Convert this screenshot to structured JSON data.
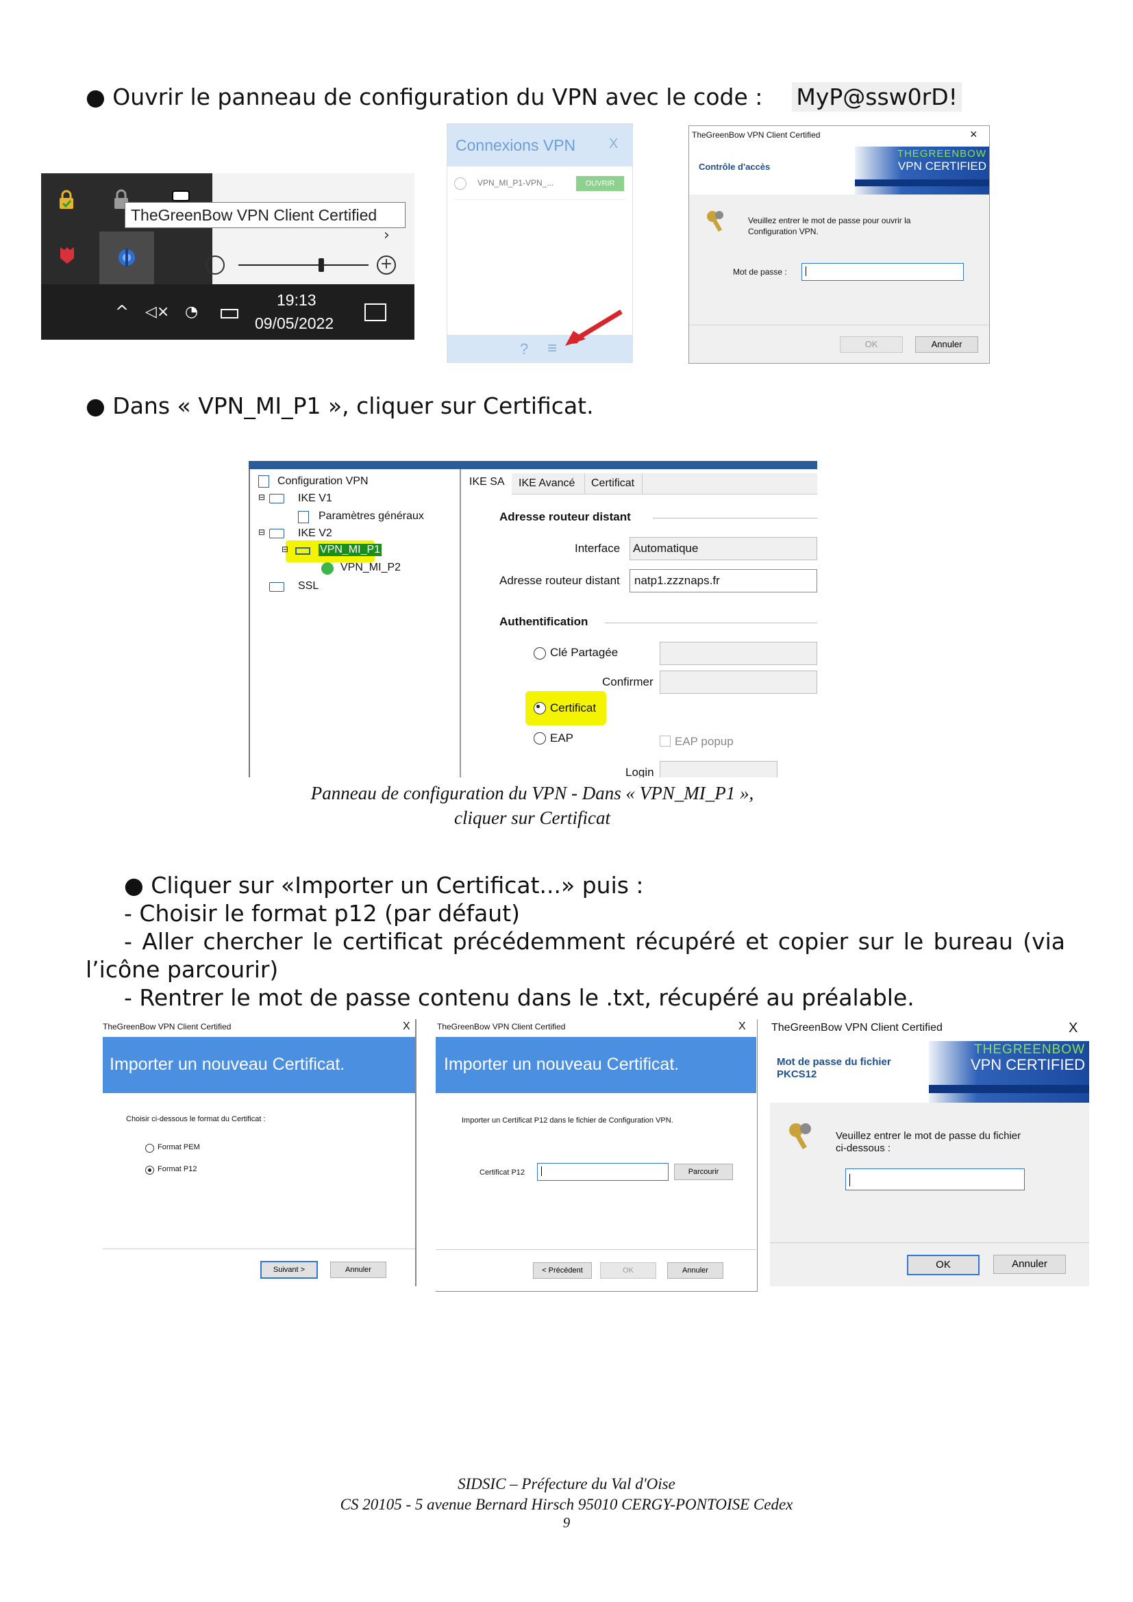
{
  "step1": {
    "bullet": "●",
    "text": "Ouvrir le panneau de configuration du VPN avec le code :",
    "code": "MyP@ssw0rD!"
  },
  "taskbar": {
    "tooltip": "TheGreenBow VPN Client Certified",
    "time": "19:13",
    "date": "09/05/2022"
  },
  "vpn_panel": {
    "title": "Connexions VPN",
    "close": "X",
    "connection_name": "VPN_MI_P1-VPN_...",
    "open_button": "OUVRIR",
    "help": "?",
    "menu": "≡"
  },
  "access_dialog": {
    "window_title": "TheGreenBow VPN Client Certified",
    "header": "Contrôle d'accès",
    "brand_top": "THEGREENBOW",
    "brand_bottom": "VPN CERTIFIED",
    "message": "Veuillez entrer le mot de passe pour ouvrir la Configuration VPN.",
    "password_label": "Mot de passe :",
    "ok": "OK",
    "cancel": "Annuler"
  },
  "step2": {
    "bullet": "●",
    "text": "Dans « VPN_MI_P1 », cliquer sur Certificat."
  },
  "config_window": {
    "tree": {
      "root": "Configuration VPN",
      "ike_v1": "IKE V1",
      "general": "Paramètres généraux",
      "ike_v2": "IKE V2",
      "vpn1": "VPN_MI_P1",
      "vpn2": "VPN_MI_P2",
      "ssl": "SSL"
    },
    "tabs": [
      "IKE SA",
      "IKE Avancé",
      "Certificat"
    ],
    "section_router": "Adresse routeur distant",
    "interface_label": "Interface",
    "interface_value": "Automatique",
    "router_label": "Adresse routeur distant",
    "router_value": "natp1.zzznaps.fr",
    "section_auth": "Authentification",
    "opt_shared": "Clé Partagée",
    "confirm_label": "Confirmer",
    "opt_cert": "Certificat",
    "opt_eap": "EAP",
    "eap_popup": "EAP popup",
    "login_label": "Login"
  },
  "caption": {
    "line1": "Panneau de configuration du VPN - Dans «  VPN_MI_P1 »,",
    "line2": "cliquer sur Certificat"
  },
  "step3": {
    "line1": "● Cliquer sur «Importer un Certificat...» puis :",
    "line2": "- Choisir le format p12 (par défaut)",
    "line3a": "- Aller chercher le certificat précédemment récupéré et copier sur le bureau (via",
    "line3b": "l’icône parcourir)",
    "line4": "- Rentrer le mot de passe contenu dans le .txt, récupéré au préalable."
  },
  "import1": {
    "window_title": "TheGreenBow VPN Client Certified",
    "close": "X",
    "header": "Importer un nouveau Certificat.",
    "instruction": "Choisir ci-dessous le format du Certificat :",
    "opt_pem": "Format PEM",
    "opt_p12": "Format P12",
    "next": "Suivant >",
    "cancel": "Annuler"
  },
  "import2": {
    "window_title": "TheGreenBow VPN Client Certified",
    "close": "X",
    "header": "Importer un nouveau Certificat.",
    "instruction": "Importer un Certificat P12 dans le fichier de Configuration VPN.",
    "cert_label": "Certificat P12",
    "browse": "Parcourir",
    "prev": "< Précédent",
    "ok": "OK",
    "cancel": "Annuler"
  },
  "pkcs_dialog": {
    "window_title": "TheGreenBow VPN Client Certified",
    "close": "X",
    "header_line1": "Mot de passe du fichier",
    "header_line2": "PKCS12",
    "brand_top": "THEGREENBOW",
    "brand_bottom": "VPN CERTIFIED",
    "message_line1": "Veuillez entrer le mot de passe du fichier",
    "message_line2": "ci-dessous :",
    "ok": "OK",
    "cancel": "Annuler"
  },
  "footer": {
    "line1": "SIDSIC – Préfecture du Val d'Oise",
    "line2": "CS 20105 - 5 avenue Bernard Hirsch  95010 CERGY-PONTOISE Cedex",
    "page": "9"
  }
}
